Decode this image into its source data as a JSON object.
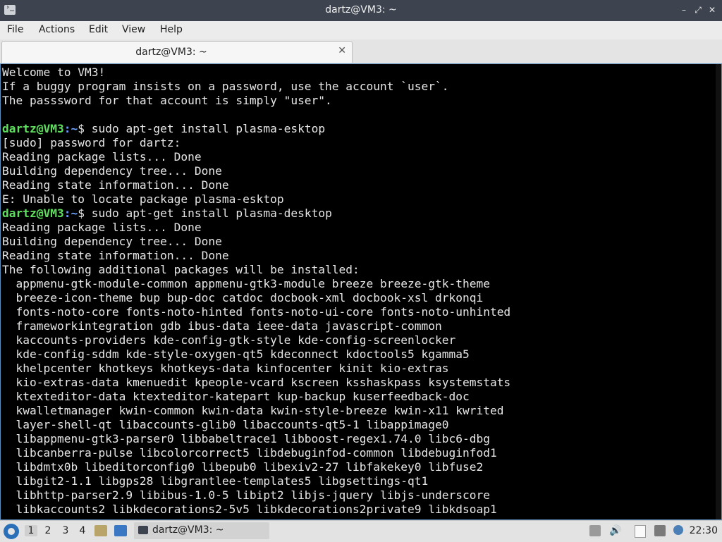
{
  "window": {
    "title": "dartz@VM3: ~",
    "controls": {
      "minimize": "–",
      "restore": "⤢",
      "close": "✕"
    }
  },
  "menubar": {
    "items": [
      "File",
      "Actions",
      "Edit",
      "View",
      "Help"
    ]
  },
  "tabs": [
    {
      "label": "dartz@VM3: ~",
      "close": "✕"
    }
  ],
  "terminal": {
    "prompt_user": "dartz@VM3",
    "prompt_path": ":~",
    "prompt_symbol": "$ ",
    "lines": [
      {
        "text": "Welcome to VM3!"
      },
      {
        "text": "If a buggy program insists on a password, use the account `user`."
      },
      {
        "text": "The passsword for that account is simply \"user\"."
      },
      {
        "text": ""
      },
      {
        "prompt": true,
        "text": "sudo apt-get install plasma-esktop"
      },
      {
        "text": "[sudo] password for dartz:"
      },
      {
        "text": "Reading package lists... Done"
      },
      {
        "text": "Building dependency tree... Done"
      },
      {
        "text": "Reading state information... Done"
      },
      {
        "text": "E: Unable to locate package plasma-esktop"
      },
      {
        "prompt": true,
        "text": "sudo apt-get install plasma-desktop"
      },
      {
        "text": "Reading package lists... Done"
      },
      {
        "text": "Building dependency tree... Done"
      },
      {
        "text": "Reading state information... Done"
      },
      {
        "text": "The following additional packages will be installed:"
      },
      {
        "text": "  appmenu-gtk-module-common appmenu-gtk3-module breeze breeze-gtk-theme"
      },
      {
        "text": "  breeze-icon-theme bup bup-doc catdoc docbook-xml docbook-xsl drkonqi"
      },
      {
        "text": "  fonts-noto-core fonts-noto-hinted fonts-noto-ui-core fonts-noto-unhinted"
      },
      {
        "text": "  frameworkintegration gdb ibus-data ieee-data javascript-common"
      },
      {
        "text": "  kaccounts-providers kde-config-gtk-style kde-config-screenlocker"
      },
      {
        "text": "  kde-config-sddm kde-style-oxygen-qt5 kdeconnect kdoctools5 kgamma5"
      },
      {
        "text": "  khelpcenter khotkeys khotkeys-data kinfocenter kinit kio-extras"
      },
      {
        "text": "  kio-extras-data kmenuedit kpeople-vcard kscreen ksshaskpass ksystemstats"
      },
      {
        "text": "  ktexteditor-data ktexteditor-katepart kup-backup kuserfeedback-doc"
      },
      {
        "text": "  kwalletmanager kwin-common kwin-data kwin-style-breeze kwin-x11 kwrited"
      },
      {
        "text": "  layer-shell-qt libaccounts-glib0 libaccounts-qt5-1 libappimage0"
      },
      {
        "text": "  libappmenu-gtk3-parser0 libbabeltrace1 libboost-regex1.74.0 libc6-dbg"
      },
      {
        "text": "  libcanberra-pulse libcolorcorrect5 libdebuginfod-common libdebuginfod1"
      },
      {
        "text": "  libdmtx0b libeditorconfig0 libepub0 libexiv2-27 libfakekey0 libfuse2"
      },
      {
        "text": "  libgit2-1.1 libgps28 libgrantlee-templates5 libgsettings-qt1"
      },
      {
        "text": "  libhttp-parser2.9 libibus-1.0-5 libipt2 libjs-jquery libjs-underscore"
      },
      {
        "text": "  libkaccounts2 libkdecorations2-5v5 libkdecorations2private9 libkdsoap1"
      }
    ]
  },
  "taskbar": {
    "desktops": [
      "1",
      "2",
      "3",
      "4"
    ],
    "active_desktop": "1",
    "task_label": "dartz@VM3: ~",
    "clock": "22:30"
  },
  "colors": {
    "prompt_user": "#5ee05e",
    "prompt_path": "#6aa0ff",
    "terminal_bg": "#000000",
    "titlebar_bg": "#3d4450"
  }
}
